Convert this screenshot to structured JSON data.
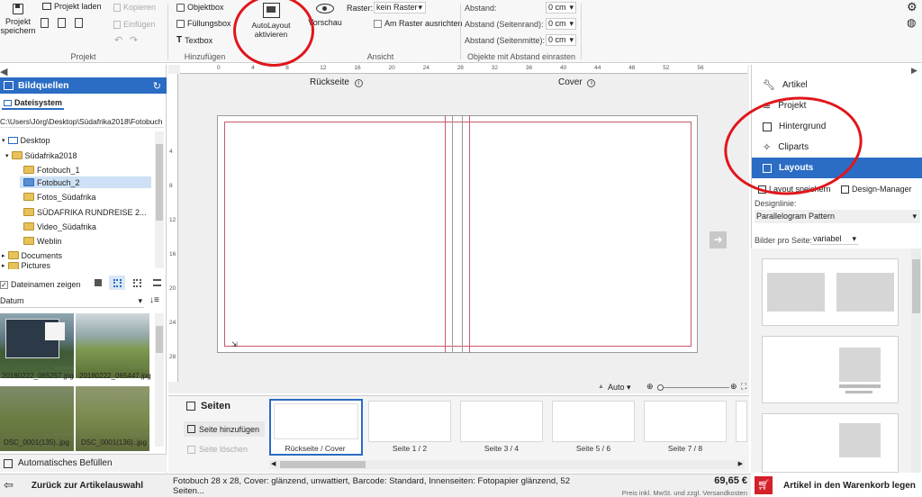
{
  "ribbon": {
    "projekt": {
      "save": "Projekt speichern",
      "load": "Projekt laden",
      "copy": "Kopieren",
      "paste": "Einfügen",
      "group_label": "Projekt"
    },
    "hinzufuegen": {
      "objektbox": "Objektbox",
      "fuellungsbox": "Füllungsbox",
      "textbox": "Textbox",
      "group_label": "Hinzufügen"
    },
    "autolayout": "AutoLayout aktivieren",
    "vorschau": "Vorschau",
    "ansicht": {
      "raster_label": "Raster:",
      "raster_value": "kein Raster",
      "snap": "Am Raster ausrichten",
      "group_label": "Ansicht"
    },
    "abstand": {
      "abstand_label": "Abstand:",
      "abstand_value": "0 cm",
      "rand_label": "Abstand (Seitenrand):",
      "rand_value": "0 cm",
      "mitte_label": "Abstand (Seitenmitte):",
      "mitte_value": "0 cm",
      "group_label": "Objekte mit Abstand einrasten"
    }
  },
  "sidebar": {
    "title": "Bildquellen",
    "tab": "Dateisystem",
    "path": "C:\\Users\\Jörg\\Desktop\\Südafrika2018\\Fotobuch",
    "tree": [
      {
        "label": "Desktop"
      },
      {
        "label": "Südafrika2018"
      },
      {
        "label": "Fotobuch_1"
      },
      {
        "label": "Fotobuch_2"
      },
      {
        "label": "Fotos_Südafrika"
      },
      {
        "label": "SÜDAFRIKA RUNDREISE 2..."
      },
      {
        "label": "Video_Südafrika"
      },
      {
        "label": "Weblin"
      },
      {
        "label": "Documents"
      },
      {
        "label": "Pictures"
      }
    ],
    "show_names": "Dateinamen zeigen",
    "sort": "Datum",
    "images": [
      {
        "name": "20180222_065257.jpg"
      },
      {
        "name": "20180222_065447.jpg"
      },
      {
        "name": "DSC_0001(135)..jpg"
      },
      {
        "name": "DSC_0001(136)..jpg"
      }
    ],
    "auto_fill": "Automatisches Befüllen"
  },
  "canvas": {
    "back_label": "Rückseite",
    "cover_label": "Cover",
    "ruler": [
      "0",
      "4",
      "8",
      "12",
      "16",
      "20",
      "24",
      "28",
      "32",
      "36",
      "40",
      "44",
      "48",
      "52",
      "56"
    ],
    "vruler": [
      "4",
      "8",
      "12",
      "16",
      "20",
      "24",
      "28"
    ],
    "zoom": "Auto"
  },
  "pages": {
    "title": "Seiten",
    "add": "Seite hinzufügen",
    "delete": "Seite löschen",
    "thumbs": [
      "Rückseite / Cover",
      "Seite 1 / 2",
      "Seite 3 / 4",
      "Seite 5 / 6",
      "Seite 7 / 8"
    ]
  },
  "right_panel": {
    "items": [
      "Artikel",
      "Projekt",
      "Hintergrund",
      "Cliparts",
      "Layouts"
    ],
    "save_layout": "Layout speichern",
    "design_manager": "Design-Manager",
    "designline_label": "Designlinie:",
    "designline_value": "Parallelogram Pattern",
    "per_page_label": "Bilder pro Seite:",
    "per_page_value": "variabel"
  },
  "footer": {
    "back": "Zurück zur Artikelauswahl",
    "description": "Fotobuch 28 x 28, Cover: glänzend, unwattiert, Barcode: Standard, Innenseiten: Fotopapier glänzend, 52 Seiten...",
    "price": "69,65 €",
    "price_note": "Preis inkl. MwSt. und zzgl. Versandkosten",
    "cart": "Artikel in den Warenkorb legen"
  },
  "colors": {
    "accent": "#2b6cc4",
    "cart_red": "#d32029",
    "annotation": "#e0161b"
  }
}
